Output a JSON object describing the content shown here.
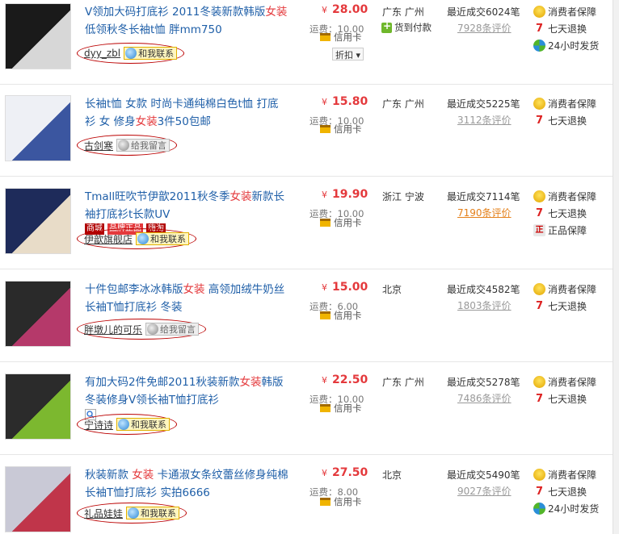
{
  "rows": [
    {
      "title_pre": "V领加大码打底衫 2011冬装新款韩版",
      "title_kw": "女装",
      "title_post": "低领秋冬长袖t恤 胖mm750",
      "seller": "dyy_zbl",
      "chat_label": "和我联系",
      "chat_online": true,
      "price": "28.00",
      "currency": "¥",
      "shipping": "运费：10.00",
      "credit": "信用卡",
      "discount": "折扣",
      "location": "广东 广州",
      "cod": "货到付款",
      "sales": "最近成交6024笔",
      "reviews": "7928条评价",
      "services": [
        "消费者保障",
        "七天退换",
        "24小时发货"
      ],
      "service_icons": [
        "guarantee-icon",
        "seven-day-return-icon",
        "24h-delivery-icon"
      ],
      "thumb_colors": [
        "#1a1a1a",
        "#d7d7d7"
      ]
    },
    {
      "title_pre": "长袖t恤 女款 时尚卡通纯棉白色t恤 打底衫 女 修身",
      "title_kw": "女装",
      "title_post": "3件50包邮",
      "seller": "古剑寒",
      "chat_label": "给我留言",
      "chat_online": false,
      "price": "15.80",
      "currency": "¥",
      "shipping": "运费：10.00",
      "credit": "信用卡",
      "location": "广东 广州",
      "sales": "最近成交5225笔",
      "reviews": "3112条评价",
      "services": [
        "消费者保障",
        "七天退换"
      ],
      "service_icons": [
        "guarantee-icon",
        "seven-day-return-icon"
      ],
      "thumb_colors": [
        "#eef0f5",
        "#3b56a0"
      ]
    },
    {
      "title_pre": "Tmall旺吹节伊歆2011秋冬季",
      "title_kw": "女装",
      "title_post": "新款长袖打底衫t长款UV",
      "badges": [
        "商城",
        "品牌正品",
        "嗨淘"
      ],
      "seller": "伊歆旗舰店",
      "chat_label": "和我联系",
      "chat_online": true,
      "price": "19.90",
      "currency": "¥",
      "shipping": "运费：10.00",
      "credit": "信用卡",
      "location": "浙江 宁波",
      "sales": "最近成交7114笔",
      "reviews": "7190条评价",
      "reviews_highlight": true,
      "services": [
        "消费者保障",
        "七天退换",
        "正品保障"
      ],
      "service_icons": [
        "guarantee-icon",
        "seven-day-return-icon",
        "authentic-icon"
      ],
      "thumb_colors": [
        "#1e2b5a",
        "#e8dcc8"
      ]
    },
    {
      "title_pre": "十件包邮李冰冰韩版",
      "title_kw": "女装",
      "title_post": " 高领加绒牛奶丝 长袖T恤打底衫 冬装",
      "seller": "胖墩儿的可乐",
      "chat_label": "给我留言",
      "chat_online": false,
      "price": "15.00",
      "currency": "¥",
      "shipping": "运费：6.00",
      "credit": "信用卡",
      "location": "北京",
      "sales": "最近成交4582笔",
      "reviews": "1803条评价",
      "services": [
        "消费者保障",
        "七天退换"
      ],
      "service_icons": [
        "guarantee-icon",
        "seven-day-return-icon"
      ],
      "thumb_colors": [
        "#2a2a2a",
        "#b5396a"
      ]
    },
    {
      "title_pre": "有加大码2件免邮2011秋装新款",
      "title_kw": "女装",
      "title_post": "韩版冬装修身V领长袖T恤打底衫",
      "seller": "宁诗诗",
      "chat_label": "和我联系",
      "chat_online": true,
      "price": "22.50",
      "currency": "¥",
      "shipping": "运费：10.00",
      "credit": "信用卡",
      "location": "广东 广州",
      "sales": "最近成交5278笔",
      "reviews": "7486条评价",
      "services": [
        "消费者保障",
        "七天退换"
      ],
      "service_icons": [
        "guarantee-icon",
        "seven-day-return-icon"
      ],
      "thumb_colors": [
        "#2b2b2b",
        "#7cb82f"
      ]
    },
    {
      "title_pre": "秋装新款 ",
      "title_kw": "女装",
      "title_post": " 卡通淑女条纹蕾丝修身纯棉长袖T恤打底衫 实拍6666",
      "seller": "礼品娃娃",
      "chat_label": "和我联系",
      "chat_online": true,
      "price": "27.50",
      "currency": "¥",
      "shipping": "运费：8.00",
      "credit": "信用卡",
      "location": "北京",
      "sales": "最近成交5490笔",
      "reviews": "9027条评价",
      "services": [
        "消费者保障",
        "七天退换",
        "24小时发货"
      ],
      "service_icons": [
        "guarantee-icon",
        "seven-day-return-icon",
        "24h-delivery-icon"
      ],
      "thumb_colors": [
        "#c9c9d6",
        "#c0354a"
      ]
    }
  ]
}
